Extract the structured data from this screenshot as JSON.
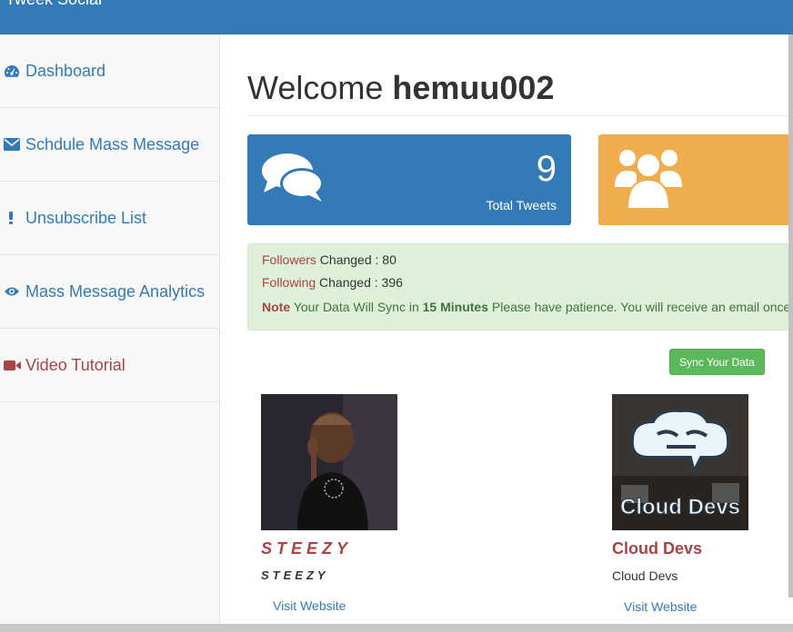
{
  "header": {
    "brand": "Tweek Social",
    "bar_color": "#337ab7"
  },
  "sidebar": {
    "items": [
      {
        "label": "Dashboard",
        "icon": "dashboard-icon"
      },
      {
        "label": "Schdule Mass Message",
        "icon": "envelope-icon"
      },
      {
        "label": "Unsubscribe List",
        "icon": "exclamation-icon"
      },
      {
        "label": "Mass Message Analytics",
        "icon": "eye-icon"
      },
      {
        "label": "Video Tutorial",
        "icon": "video-camera-icon"
      }
    ]
  },
  "main": {
    "welcome": "Welcome",
    "username": "hemuu002",
    "cards": [
      {
        "value": "9",
        "label": "Total Tweets",
        "icon": "comments-icon",
        "color": "#337ab7"
      },
      {
        "value": "",
        "label": "",
        "icon": "users-icon",
        "color": "#f0ad4e"
      }
    ],
    "alert": {
      "followers_label": "Followers",
      "followers_text": "Changed : 80",
      "following_label": "Following",
      "following_text": "Changed : 396",
      "note_label": "Note",
      "note_pre": "Your Data Will Sync in",
      "note_time": "15 Minutes",
      "note_post": "Please have patience. You will receive an email once"
    },
    "sync_button": "Sync Your Data",
    "profiles": [
      {
        "name": "STEEZY",
        "subtitle": "STEEZY",
        "link": "Visit Website"
      },
      {
        "name": "Cloud Devs",
        "subtitle": "Cloud Devs",
        "link": "Visit Website",
        "image_text": "Cloud Devs"
      }
    ]
  }
}
